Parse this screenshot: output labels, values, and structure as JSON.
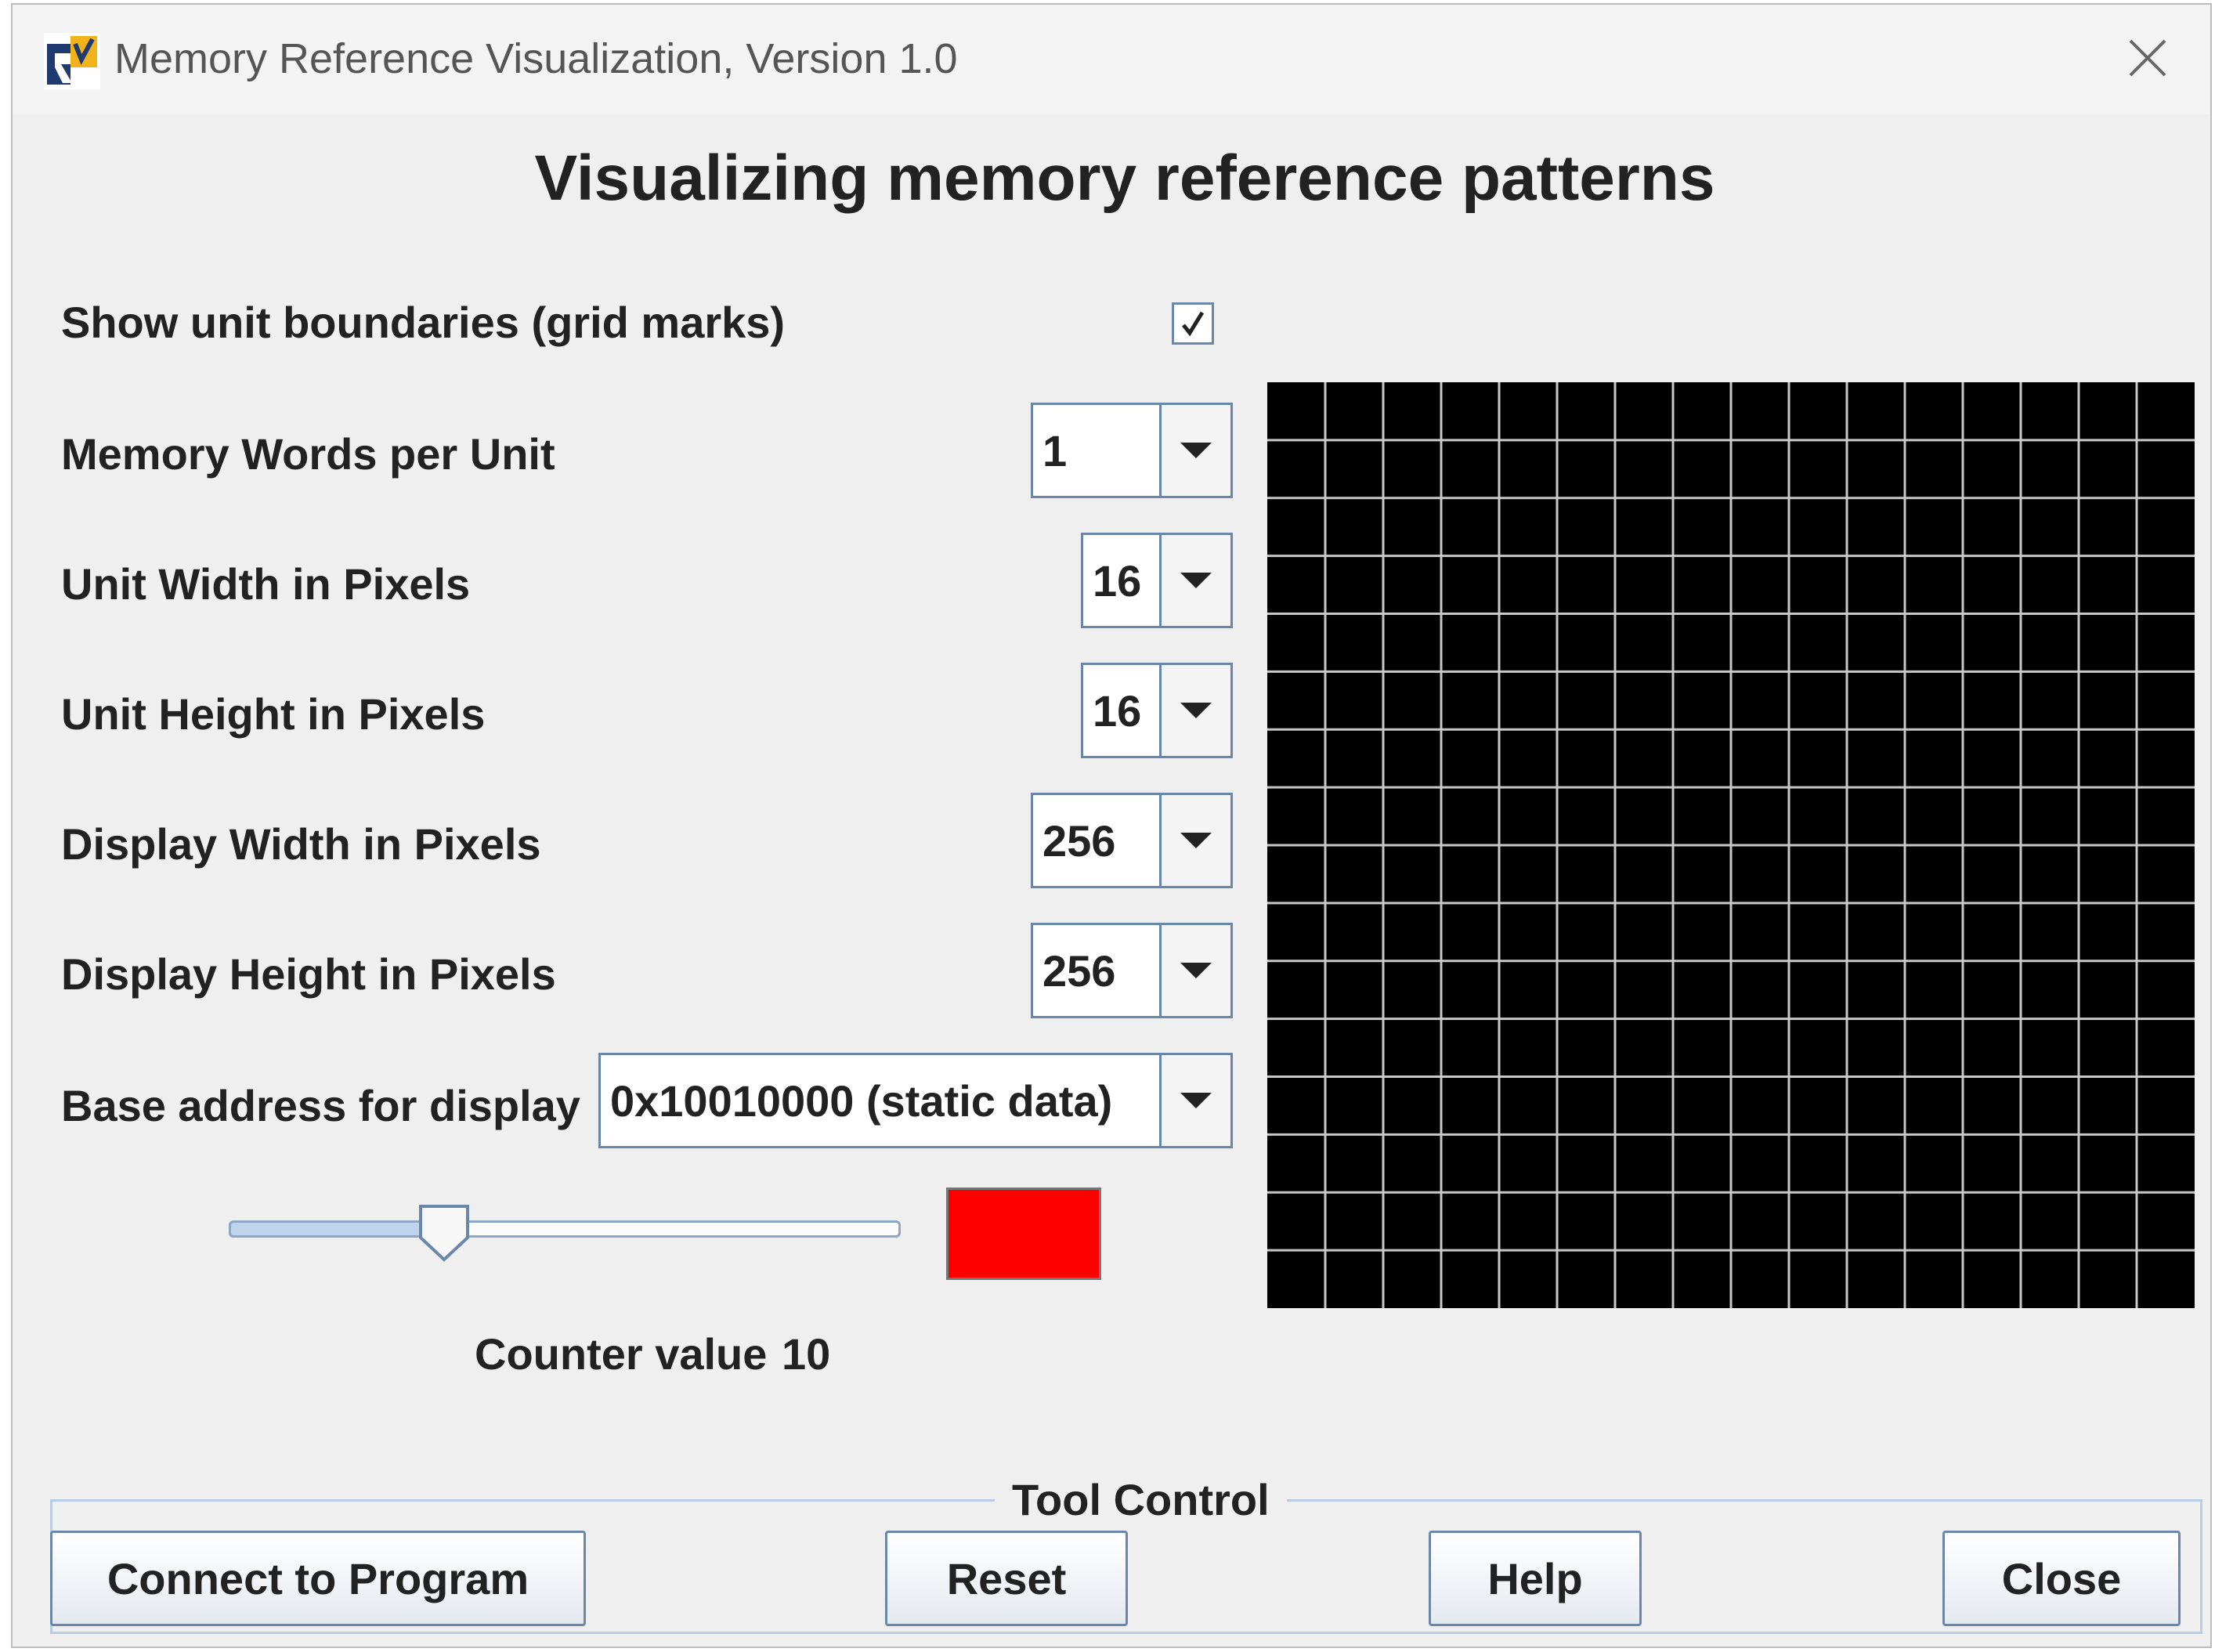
{
  "window": {
    "title": "Memory Reference Visualization, Version 1.0",
    "heading": "Visualizing memory reference patterns"
  },
  "options": {
    "grid_marks": {
      "label": "Show unit boundaries (grid marks)",
      "checked": true
    },
    "words_per_unit": {
      "label": "Memory Words per Unit",
      "value": "1"
    },
    "unit_width": {
      "label": "Unit Width in Pixels",
      "value": "16"
    },
    "unit_height": {
      "label": "Unit Height in Pixels",
      "value": "16"
    },
    "display_width": {
      "label": "Display Width in Pixels",
      "value": "256"
    },
    "display_height": {
      "label": "Display Height in Pixels",
      "value": "256"
    },
    "base_address": {
      "label": "Base address for display",
      "value": "0x10010000 (static data)"
    }
  },
  "counter": {
    "label": "Counter value",
    "value": "10",
    "slider_fraction": 0.32,
    "color": "#ff0000"
  },
  "display_grid": {
    "columns": 16,
    "rows": 16,
    "cell_color": "#000000",
    "line_color": "#c8c8c8"
  },
  "tool_control": {
    "legend": "Tool Control",
    "buttons": {
      "connect": "Connect to Program",
      "reset": "Reset",
      "help": "Help",
      "close": "Close"
    }
  },
  "icons": {
    "logo": "rars-logo-icon",
    "close": "close-icon",
    "dropdown": "chevron-down-icon",
    "check": "checkmark-icon"
  }
}
